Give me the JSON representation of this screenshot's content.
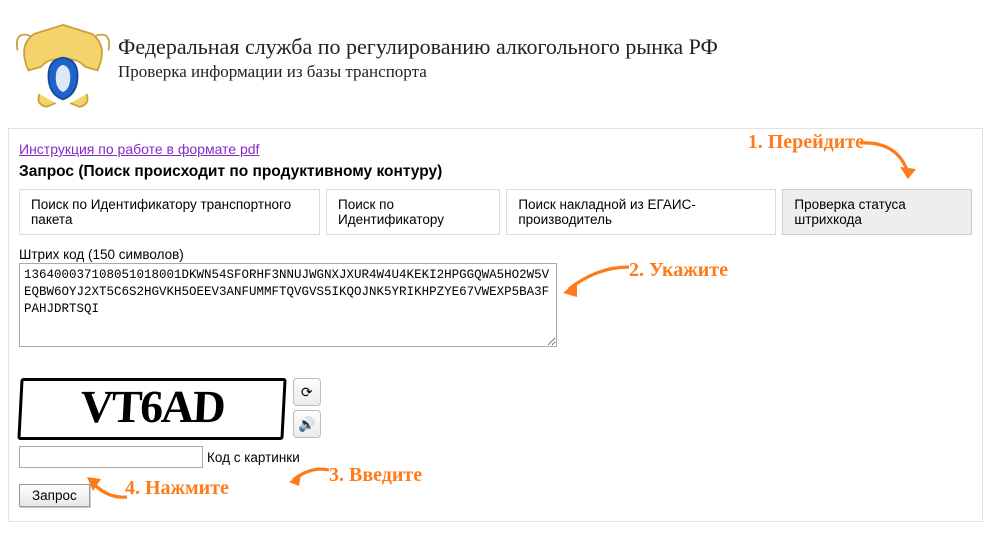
{
  "header": {
    "title": "Федеральная служба по регулированию алкогольного рынка РФ",
    "subtitle": "Проверка информации из базы транспорта"
  },
  "panel": {
    "pdf_link": "Инструкция по работе в формате pdf",
    "request_title": "Запрос (Поиск происходит по продуктивному контуру)",
    "tabs": {
      "t1": "Поиск по Идентификатору транспортного пакета",
      "t2": "Поиск по Идентификатору",
      "t3": "Поиск накладной из ЕГАИС-производитель",
      "t4": "Проверка статуса штрихкода"
    },
    "barcode_label": "Штрих код (150 символов)",
    "barcode_value": "136400037108051018001DKWN54SFORHF3NNUJWGNXJXUR4W4U4KEKI2HPGGQWA5HO2W5VEQBW6OYJ2XT5C6S2HGVKH5OEEV3ANFUMMFTQVGVS5IKQOJNK5YRIKHPZYE67VWEXP5BA3FPAHJDRTSQI",
    "captcha_text": "VT6AD",
    "captcha_label": "Код с картинки",
    "submit": "Запрос"
  },
  "annotations": {
    "a1": "1. Перейдите",
    "a2": "2. Укажите",
    "a3": "3. Введите",
    "a4": "4. Нажмите"
  },
  "icons": {
    "refresh": "⟳",
    "sound": "🔊"
  }
}
